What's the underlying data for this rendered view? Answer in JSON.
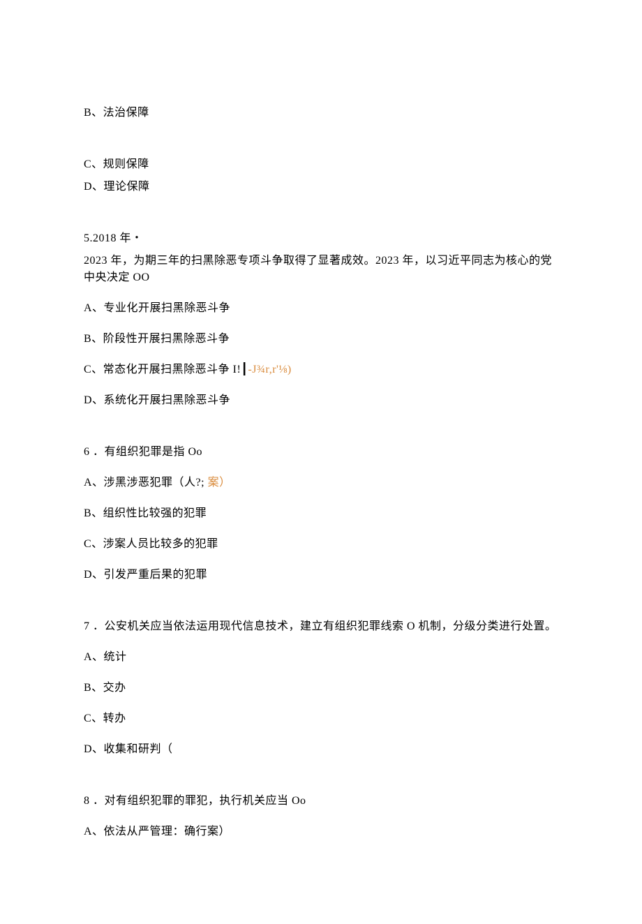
{
  "q4": {
    "optB": "B、法治保障",
    "optC": "C、规则保障",
    "optD": "D、理论保障"
  },
  "q5": {
    "header": "5.2018 年・",
    "stem": "2023 年，为期三年的扫黑除恶专项斗争取得了显著成效。2023 年，以习近平同志为核心的党中央决定 OO",
    "optA": "A、专业化开展扫黑除恶斗争",
    "optB": "B、阶段性开展扫黑除恶斗争",
    "optC_main": "C、常态化开展扫黑除恶斗争 I!┃",
    "optC_mark": "-J¾r,r'⅛)",
    "optD": "D、系统化开展扫黑除恶斗争"
  },
  "q6": {
    "stem": "6 ．有组织犯罪是指 Oo",
    "optA_main": "A、涉黑涉恶犯罪（人?; ",
    "optA_mark": "案）",
    "optB": "B、组织性比较强的犯罪",
    "optC": "C、涉案人员比较多的犯罪",
    "optD": "D、引发严重后果的犯罪"
  },
  "q7": {
    "stem": "7 ．公安机关应当依法运用现代信息技术，建立有组织犯罪线索 O 机制，分级分类进行处置。",
    "optA": "A、统计",
    "optB": "B、交办",
    "optC": "C、转办",
    "optD": "D、收集和研判（"
  },
  "q8": {
    "stem": "8 ．对有组织犯罪的罪犯，执行机关应当 Oo",
    "optA": "A、依法从严管理：确行案）"
  }
}
